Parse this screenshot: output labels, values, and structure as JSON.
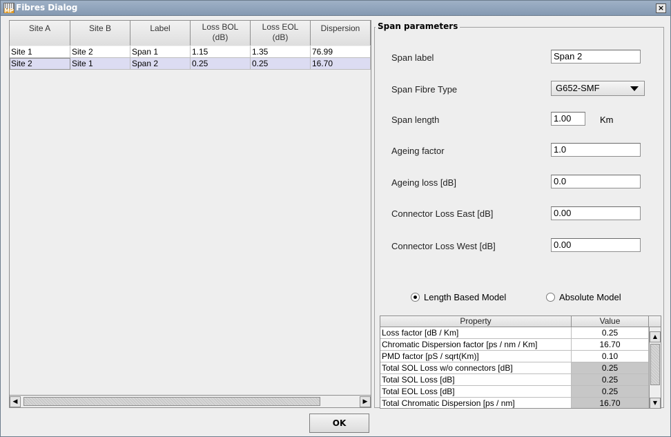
{
  "window": {
    "title": "Fibres Dialog",
    "icon_top": "|||||",
    "icon_bottom": "MP",
    "close_glyph": "×"
  },
  "spans_table": {
    "columns": [
      "Site A",
      "Site B",
      "Label",
      "Loss BOL\n(dB)",
      "Loss EOL\n(dB)",
      "Dispersion"
    ],
    "rows": [
      [
        "Site 1",
        "Site 2",
        "Span 1",
        "1.15",
        "1.35",
        "76.99"
      ],
      [
        "Site 2",
        "Site 1",
        "Span 2",
        "0.25",
        "0.25",
        "16.70"
      ]
    ],
    "selected_row": 1
  },
  "span_parameters": {
    "title": "Span parameters",
    "span_label": {
      "label": "Span label",
      "value": "Span 2"
    },
    "fibre_type": {
      "label": "Span Fibre Type",
      "value": "G652-SMF"
    },
    "span_length": {
      "label": "Span length",
      "value": "1.00",
      "unit": "Km"
    },
    "ageing_factor": {
      "label": "Ageing factor",
      "value": "1.0"
    },
    "ageing_loss": {
      "label": "Ageing loss  [dB]",
      "value": "0.0"
    },
    "conn_east": {
      "label": "Connector Loss East [dB]",
      "value": "0.00"
    },
    "conn_west": {
      "label": "Connector Loss West [dB]",
      "value": "0.00"
    },
    "model_length": "Length Based Model",
    "model_absolute": "Absolute Model",
    "selected_model": "length"
  },
  "property_table": {
    "header_property": "Property",
    "header_value": "Value",
    "rows": [
      {
        "name": "Loss factor [dB / Km]",
        "value": "0.25"
      },
      {
        "name": "Chromatic Dispersion factor [ps / nm / Km]",
        "value": "16.70"
      },
      {
        "name": "PMD factor [pS / sqrt(Km)]",
        "value": "0.10"
      },
      {
        "name": "Total SOL Loss w/o connectors [dB]",
        "value": "0.25"
      },
      {
        "name": "Total SOL Loss [dB]",
        "value": "0.25"
      },
      {
        "name": "Total EOL Loss [dB]",
        "value": "0.25"
      },
      {
        "name": "Total Chromatic Dispersion [ps / nm]",
        "value": "16.70"
      }
    ]
  },
  "footer": {
    "ok_label": "OK"
  }
}
